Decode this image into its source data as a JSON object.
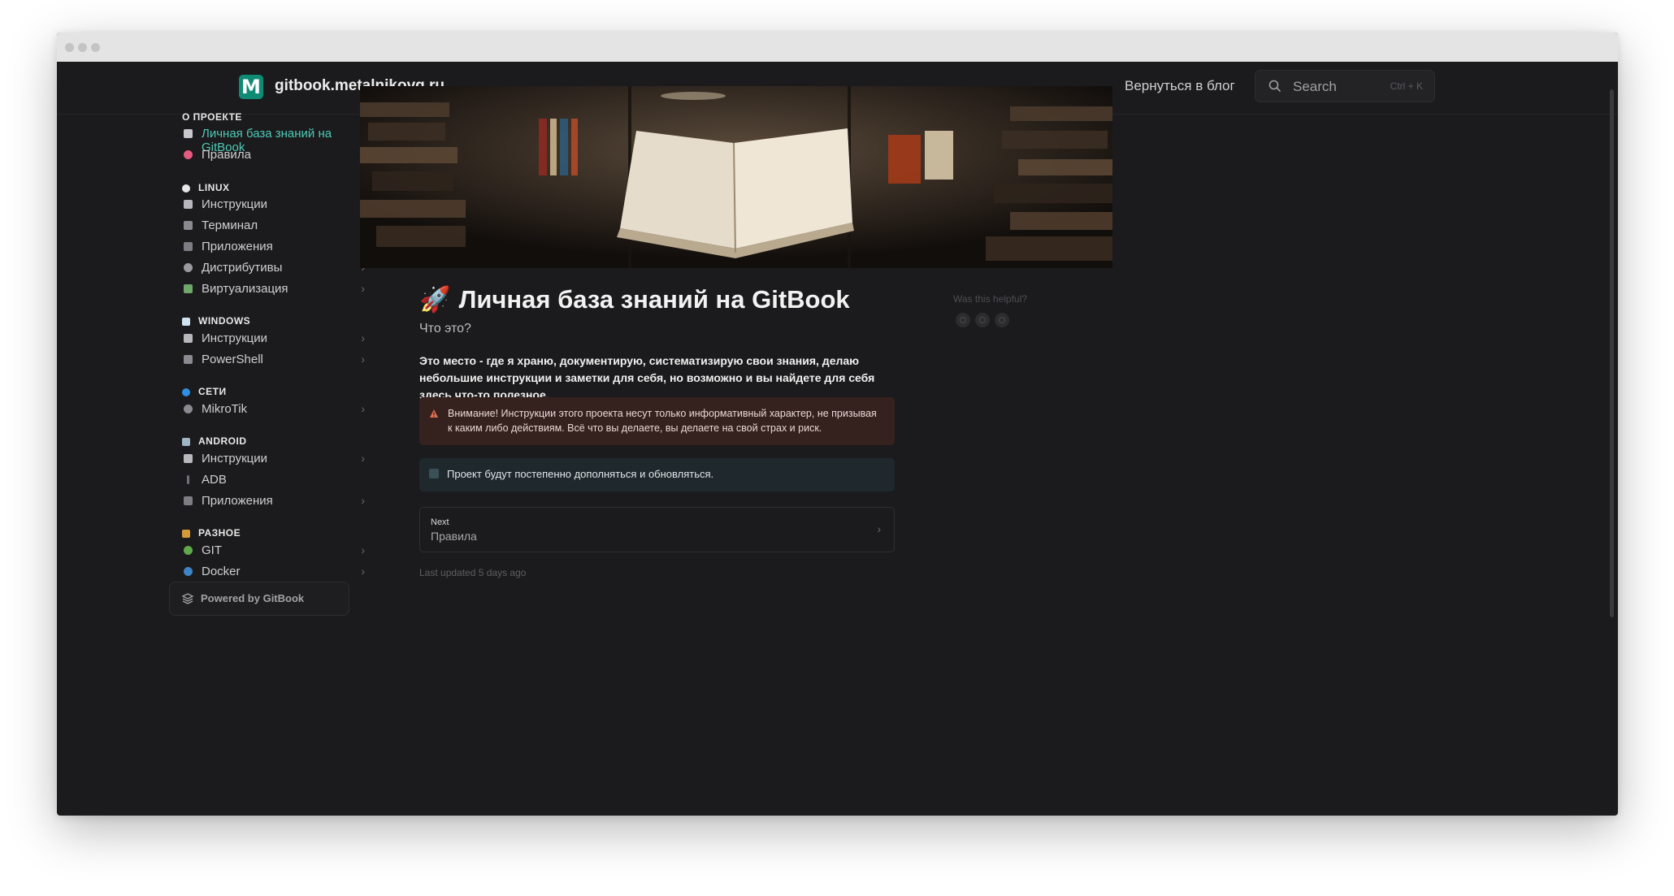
{
  "site": {
    "title": "gitbook.metalnikovg.ru",
    "logo_letter": "M"
  },
  "nav": {
    "back_link": "Вернуться в блог"
  },
  "search": {
    "placeholder": "Search",
    "shortcut": "Ctrl + K"
  },
  "sidebar": {
    "sections": [
      {
        "title": "О ПРОЕКТЕ",
        "icon": "none"
      },
      {
        "title": "LINUX",
        "icon": "penguin-icon"
      },
      {
        "title": "WINDOWS",
        "icon": "window-icon"
      },
      {
        "title": "СЕТИ",
        "icon": "globe-icon"
      },
      {
        "title": "ANDROID",
        "icon": "phone-icon"
      },
      {
        "title": "РАЗНОЕ",
        "icon": "folder-icon"
      }
    ],
    "items": [
      {
        "label": "Личная база знаний на GitBook",
        "icon": "rocket-icon"
      },
      {
        "label": "Правила",
        "icon": "heart-icon"
      },
      {
        "label": "Инструкции",
        "icon": "page-icon"
      },
      {
        "label": "Терминал",
        "icon": "terminal-icon"
      },
      {
        "label": "Приложения",
        "icon": "laptop-icon"
      },
      {
        "label": "Дистрибутивы",
        "icon": "disc-icon"
      },
      {
        "label": "Виртуализация",
        "icon": "pencil-icon"
      },
      {
        "label": "Инструкции",
        "icon": "page-icon"
      },
      {
        "label": "PowerShell",
        "icon": "terminal-icon"
      },
      {
        "label": "MikroTik",
        "icon": "gear-icon"
      },
      {
        "label": "Инструкции",
        "icon": "page-icon"
      },
      {
        "label": "ADB",
        "icon": "tool-icon"
      },
      {
        "label": "Приложения",
        "icon": "laptop-icon"
      },
      {
        "label": "GIT",
        "icon": "palm-icon"
      },
      {
        "label": "Docker",
        "icon": "whale-icon"
      }
    ],
    "powered_by": "Powered by GitBook"
  },
  "page": {
    "title_icon": "🚀",
    "title": "Личная база знаний на GitBook",
    "subtitle": "Что это?",
    "lead": "Это место - где я храню, документирую, систематизирую свои знания, делаю небольшие инструкции и заметки для себя, но возможно и вы найдете для себя здесь что-то полезное.",
    "warning": "Внимание! Инструкции этого проекта несут только информативный характер, не призывая к каким либо действиям. Всё что вы делаете, вы делаете на свой страх и риск.",
    "note": "Проект будут постепенно дополняться и обновляться.",
    "next_label": "Next",
    "next_title": "Правила",
    "last_updated": "Last updated 5 days ago"
  },
  "feedback": {
    "question": "Was this helpful?"
  },
  "colors": {
    "accent": "#4fc9b6",
    "background": "#1b1b1d",
    "logo": "#0f8a74",
    "warning_bg": "#35221f",
    "note_bg": "#1f292d"
  }
}
